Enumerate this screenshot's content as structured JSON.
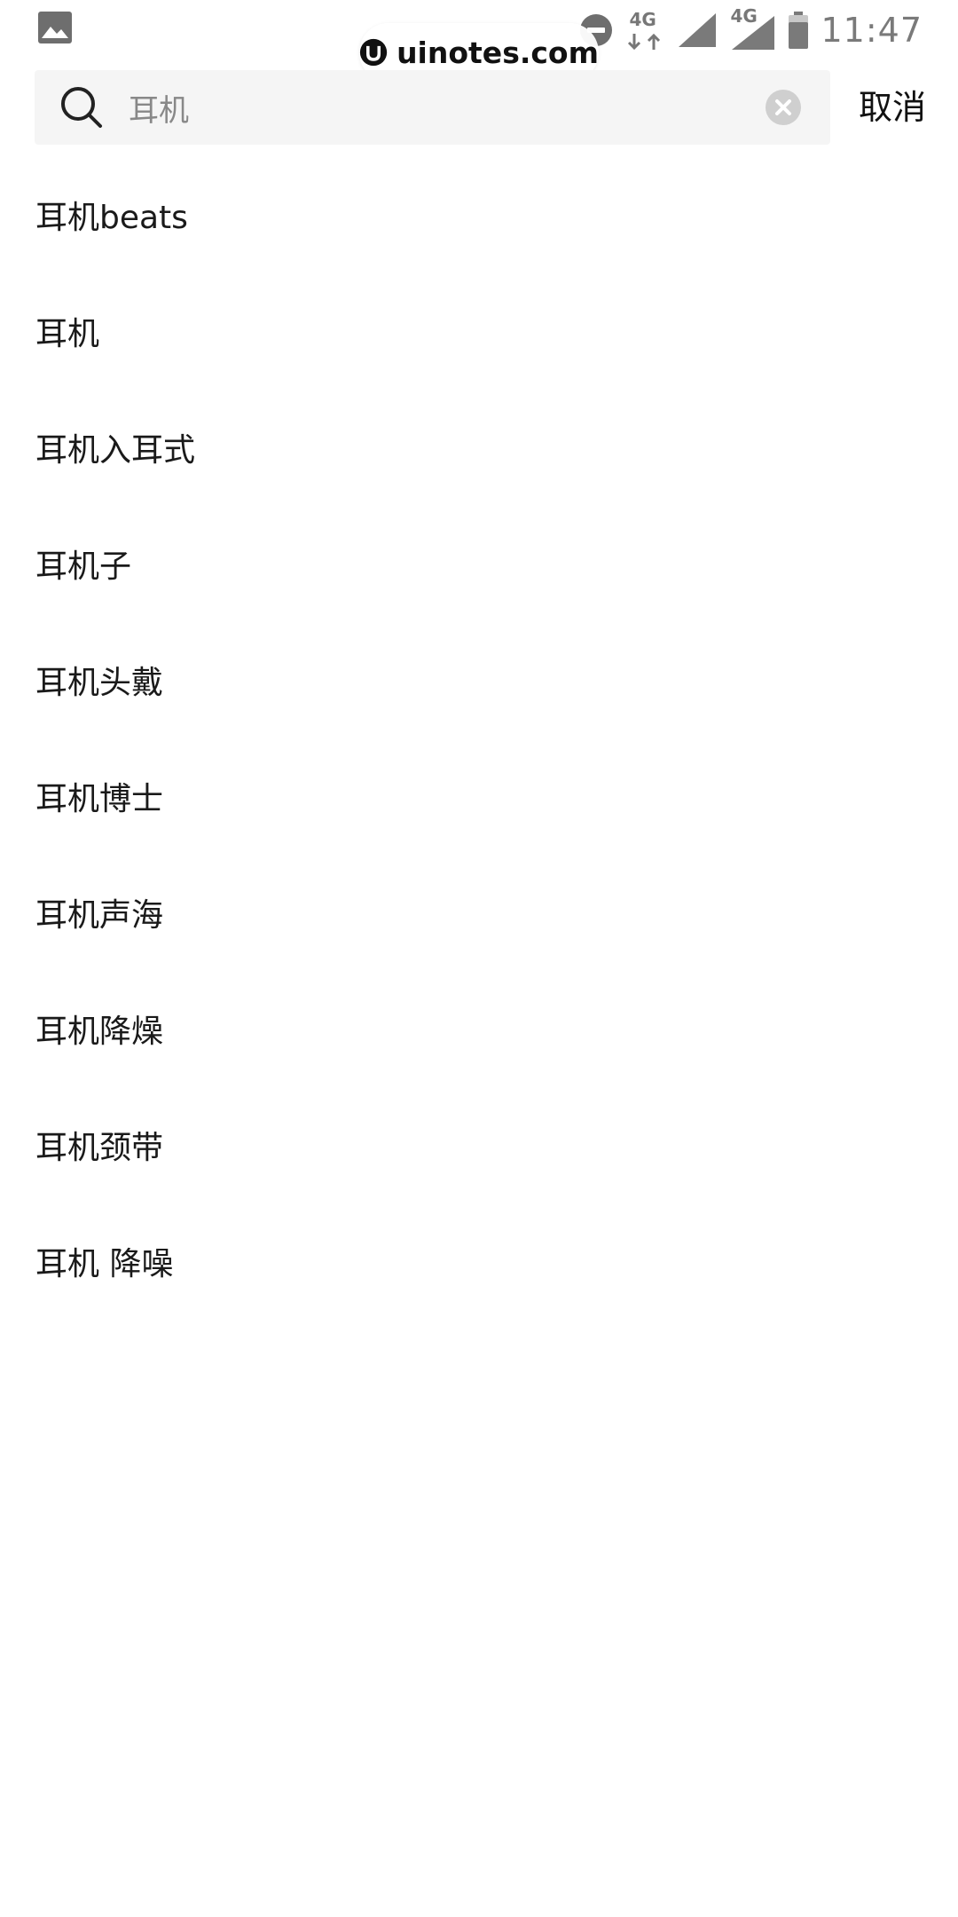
{
  "status_bar": {
    "time": "11:47",
    "network_1": "4G",
    "network_2": "4G",
    "icons": [
      "image-notification-icon",
      "do-not-disturb-icon",
      "data-arrows-icon",
      "signal-icon",
      "signal-icon",
      "battery-icon"
    ]
  },
  "watermark": {
    "text": "uinotes.com",
    "icon": "uinotes-logo-icon"
  },
  "search": {
    "value": "耳机",
    "search_icon": "search-icon",
    "clear_icon": "clear-icon",
    "cancel_label": "取消"
  },
  "suggestions": [
    {
      "label": "耳机beats"
    },
    {
      "label": "耳机"
    },
    {
      "label": "耳机入耳式"
    },
    {
      "label": "耳机子"
    },
    {
      "label": "耳机头戴"
    },
    {
      "label": "耳机博士"
    },
    {
      "label": "耳机声海"
    },
    {
      "label": "耳机降燥"
    },
    {
      "label": "耳机颈带"
    },
    {
      "label": "耳机 降噪"
    }
  ],
  "colors": {
    "background": "#ffffff",
    "search_box": "#f5f5f5",
    "text_primary": "#1a1a1a",
    "text_secondary": "#888888",
    "status_icons": "#777777"
  }
}
